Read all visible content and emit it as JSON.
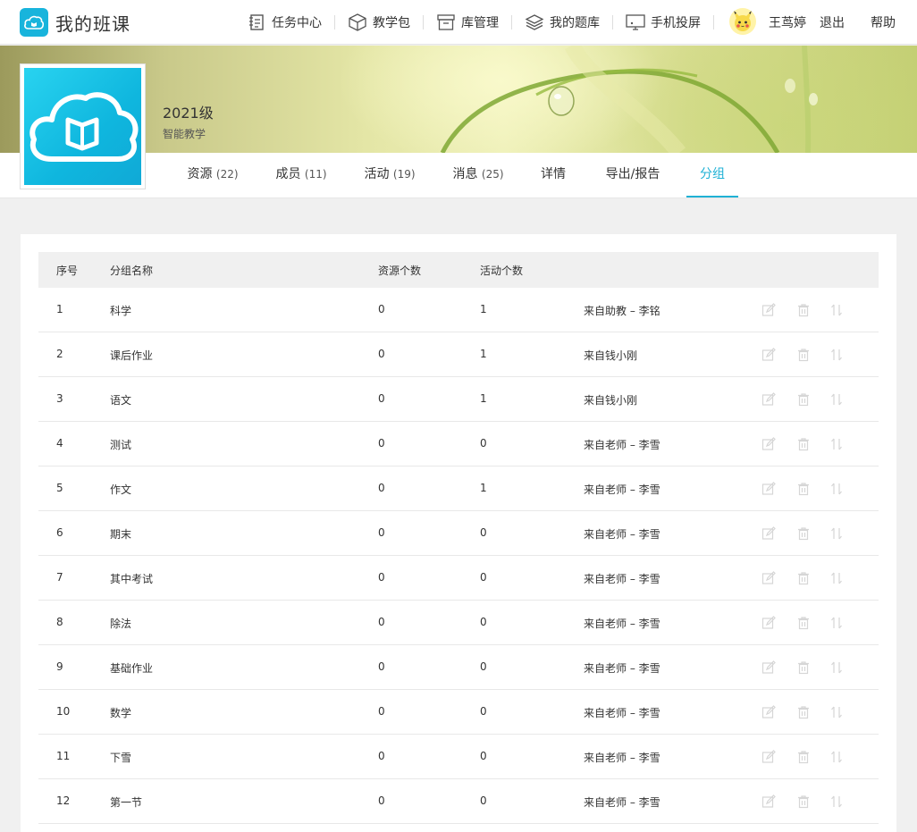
{
  "app": {
    "title": "我的班课"
  },
  "topnav": [
    {
      "label": "任务中心",
      "icon": "task-icon"
    },
    {
      "label": "教学包",
      "icon": "package-icon"
    },
    {
      "label": "库管理",
      "icon": "archive-icon"
    },
    {
      "label": "我的题库",
      "icon": "layers-icon"
    },
    {
      "label": "手机投屏",
      "icon": "screen-cast-icon"
    }
  ],
  "user": {
    "name": "王茑婷",
    "logout": "退出",
    "help": "帮助"
  },
  "course": {
    "title": "2021级",
    "subtitle": "智能教学"
  },
  "tabs": [
    {
      "label": "资源",
      "count": "(22)"
    },
    {
      "label": "成员",
      "count": "(11)"
    },
    {
      "label": "活动",
      "count": "(19)"
    },
    {
      "label": "消息",
      "count": "(25)"
    },
    {
      "label": "详情",
      "count": ""
    },
    {
      "label": "导出/报告",
      "count": ""
    },
    {
      "label": "分组",
      "count": ""
    }
  ],
  "active_tab": "分组",
  "table": {
    "headers": {
      "index": "序号",
      "name": "分组名称",
      "resources": "资源个数",
      "activities": "活动个数"
    },
    "rows": [
      {
        "index": "1",
        "name": "科学",
        "resources": "0",
        "activities": "1",
        "source": "来自助教 – 李铭"
      },
      {
        "index": "2",
        "name": "课后作业",
        "resources": "0",
        "activities": "1",
        "source": "来自钱小刚"
      },
      {
        "index": "3",
        "name": "语文",
        "resources": "0",
        "activities": "1",
        "source": "来自钱小刚"
      },
      {
        "index": "4",
        "name": "测试",
        "resources": "0",
        "activities": "0",
        "source": "来自老师 – 李雪"
      },
      {
        "index": "5",
        "name": "作文",
        "resources": "0",
        "activities": "1",
        "source": "来自老师 – 李雪"
      },
      {
        "index": "6",
        "name": "期末",
        "resources": "0",
        "activities": "0",
        "source": "来自老师 – 李雪"
      },
      {
        "index": "7",
        "name": "其中考试",
        "resources": "0",
        "activities": "0",
        "source": "来自老师 – 李雪"
      },
      {
        "index": "8",
        "name": "除法",
        "resources": "0",
        "activities": "0",
        "source": "来自老师 – 李雪"
      },
      {
        "index": "9",
        "name": "基础作业",
        "resources": "0",
        "activities": "0",
        "source": "来自老师 – 李雪"
      },
      {
        "index": "10",
        "name": "数学",
        "resources": "0",
        "activities": "0",
        "source": "来自老师 – 李雪"
      },
      {
        "index": "11",
        "name": "下雪",
        "resources": "0",
        "activities": "0",
        "source": "来自老师 – 李雪"
      },
      {
        "index": "12",
        "name": "第一节",
        "resources": "0",
        "activities": "0",
        "source": "来自老师 – 李雪"
      }
    ]
  },
  "colors": {
    "accent": "#1fb1d5",
    "icon_disabled": "#d6d6d6"
  }
}
